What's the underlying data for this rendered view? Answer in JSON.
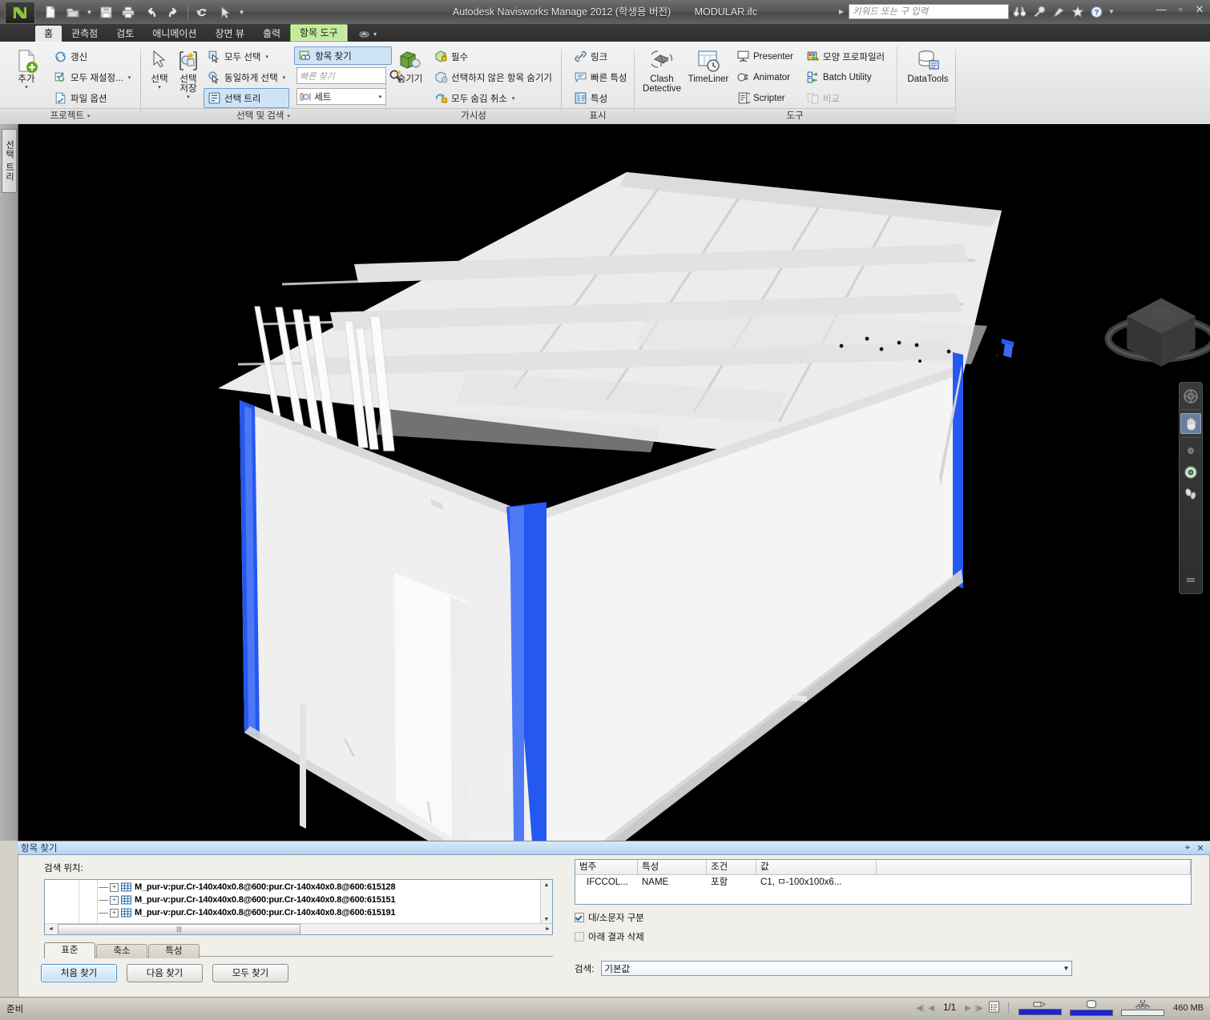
{
  "window": {
    "app_title": "Autodesk Navisworks Manage 2012 (학생용 버전)",
    "file_name": "MODULAR.ifc",
    "minimize": "—",
    "maximize": "▫",
    "close": "✕"
  },
  "quick_access": [
    {
      "name": "new-file-icon",
      "label": "새로 만들기"
    },
    {
      "name": "open-file-icon",
      "label": "열기"
    },
    {
      "name": "open-dropdown-caret",
      "label": "▾"
    },
    {
      "name": "save-icon",
      "label": "저장"
    },
    {
      "name": "print-icon",
      "label": "인쇄"
    },
    {
      "name": "undo-icon",
      "label": "실행 취소"
    },
    {
      "name": "redo-icon",
      "label": "다시 실행"
    },
    {
      "name": "refresh-icon",
      "label": "갱신"
    },
    {
      "name": "select-cursor-icon",
      "label": "선택"
    },
    {
      "name": "qat-dropdown-caret",
      "label": "▾"
    }
  ],
  "title_search": {
    "placeholder": "키워드 또는 구 입력",
    "caret": "▸",
    "icons": [
      "binoculars-icon",
      "wrench-icon",
      "satellite-icon",
      "star-icon",
      "help-icon"
    ],
    "help_caret": "▾"
  },
  "tabs": [
    {
      "label": "홈",
      "state": "active"
    },
    {
      "label": "관측점",
      "state": "normal"
    },
    {
      "label": "검토",
      "state": "normal"
    },
    {
      "label": "애니메이션",
      "state": "normal"
    },
    {
      "label": "장면 뷰",
      "state": "normal"
    },
    {
      "label": "출력",
      "state": "normal"
    },
    {
      "label": "항목 도구",
      "state": "contextual"
    }
  ],
  "ribbon": {
    "groups": [
      {
        "title": "프로젝트",
        "caret": "▾",
        "big": {
          "label": "추가",
          "caret": "▾",
          "icon": "add-file-icon"
        },
        "items": [
          {
            "label": "갱신",
            "icon": "refresh-icon",
            "caret": ""
          },
          {
            "label": "모두 재설정...",
            "icon": "reset-all-icon",
            "caret": "▾"
          },
          {
            "label": "파일 옵션",
            "icon": "file-options-icon",
            "caret": ""
          }
        ]
      },
      {
        "title": "선택 및 검색",
        "caret": "▾",
        "big": [
          {
            "label": "선택",
            "caret": "▾",
            "icon": "select-arrow-icon"
          },
          {
            "label": "선택 저장",
            "caret": "▾",
            "icon": "save-selection-icon"
          }
        ],
        "items": [
          {
            "label": "모두 선택",
            "icon": "select-all-icon",
            "caret": "▾"
          },
          {
            "label": "동일하게 선택",
            "icon": "select-same-icon",
            "caret": "▾"
          },
          {
            "label": "선택 트리",
            "icon": "selection-tree-icon",
            "caret": "",
            "selected": true
          }
        ],
        "items2": [
          {
            "label": "항목 찾기",
            "icon": "find-items-icon",
            "selected": true
          },
          {
            "label": "빠른 찾기",
            "icon": "quick-find-icon",
            "placeholder": true
          },
          {
            "label": "세트",
            "icon": "sets-icon",
            "caret": "▾"
          }
        ]
      },
      {
        "title": "가시성",
        "caret": "",
        "big": {
          "label": "숨기기",
          "caret": "",
          "icon": "hide-icon"
        },
        "items": [
          {
            "label": "필수",
            "icon": "required-icon",
            "caret": ""
          },
          {
            "label": "선택하지 않은 항목 숨기기",
            "icon": "hide-unselected-icon",
            "caret": ""
          },
          {
            "label": "모두 숨김 취소",
            "icon": "unhide-all-icon",
            "caret": "▾"
          }
        ]
      },
      {
        "title": "표시",
        "caret": "",
        "items": [
          {
            "label": "링크",
            "icon": "link-icon"
          },
          {
            "label": "빠른 특성",
            "icon": "quick-properties-icon"
          },
          {
            "label": "특성",
            "icon": "properties-icon"
          }
        ]
      },
      {
        "title": "도구",
        "caret": "",
        "big": [
          {
            "label": "Clash Detective",
            "icon": "clash-detective-icon"
          },
          {
            "label": "TimeLiner",
            "icon": "timeliner-icon"
          }
        ],
        "items": [
          {
            "label": "Presenter",
            "icon": "presenter-icon"
          },
          {
            "label": "Animator",
            "icon": "animator-icon"
          },
          {
            "label": "Scripter",
            "icon": "scripter-icon"
          }
        ],
        "items2": [
          {
            "label": "모양 프로파일러",
            "icon": "appearance-profiler-icon"
          },
          {
            "label": "Batch Utility",
            "icon": "batch-utility-icon"
          },
          {
            "label": "비교",
            "icon": "compare-icon",
            "disabled": true
          }
        ],
        "items3": [
          {
            "label": "DataTools",
            "icon": "datatools-icon"
          }
        ]
      }
    ]
  },
  "left_dock": {
    "tab_label": "선택 트리"
  },
  "viewport": {
    "background_color": "#000000",
    "selection_color": "#2458f0",
    "model_color": "#f2f2f2",
    "viewcube_name": "view-cube",
    "navbar_items": [
      {
        "name": "steering-wheel-icon",
        "active": false
      },
      {
        "name": "pan-hand-icon",
        "active": true
      },
      {
        "name": "zoom-icon",
        "active": false
      },
      {
        "name": "orbit-icon",
        "active": false
      },
      {
        "name": "walk-icon",
        "active": false
      },
      {
        "name": "navbar-menu-icon",
        "active": false
      }
    ]
  },
  "find_items": {
    "title": "항목 찾기",
    "pin": "⌖",
    "close": "✕",
    "search_in_label": "검색 위치:",
    "tree_rows": [
      {
        "expander": "+",
        "label": "M_pur-v:pur.Cr-140x40x0.8@600:pur.Cr-140x40x0.8@600:615128"
      },
      {
        "expander": "+",
        "label": "M_pur-v:pur.Cr-140x40x0.8@600:pur.Cr-140x40x0.8@600:615151"
      },
      {
        "expander": "+",
        "label": "M_pur-v:pur.Cr-140x40x0.8@600:pur.Cr-140x40x0.8@600:615191"
      }
    ],
    "scroll": {
      "up": "▲",
      "down": "▼",
      "left": "◄",
      "right": "►",
      "grip": "|||"
    },
    "bottom_tabs": [
      {
        "label": "표준",
        "active": true
      },
      {
        "label": "축소",
        "active": false
      },
      {
        "label": "특성",
        "active": false
      }
    ],
    "buttons": [
      {
        "label": "처음 찾기",
        "primary": true
      },
      {
        "label": "다음 찾기",
        "primary": false
      },
      {
        "label": "모두 찾기",
        "primary": false
      }
    ],
    "grid": {
      "headers": [
        "범주",
        "특성",
        "조건",
        "값",
        ""
      ],
      "rows": [
        {
          "category": "IFCCOL...",
          "property": "NAME",
          "condition": "포함",
          "value": "C1, ㅁ-100x100x6...",
          "extra": ""
        }
      ]
    },
    "checkboxes": [
      {
        "label": "대/소문자 구분",
        "checked": true
      },
      {
        "label": "아래 결과 삭제",
        "checked": false
      }
    ],
    "search_mode": {
      "label": "검색:",
      "value": "기본값",
      "caret": "▼"
    }
  },
  "status_bar": {
    "ready": "준비",
    "nav": {
      "first": "◀|",
      "prev": "◀",
      "next": "▶",
      "last": "|▶"
    },
    "page": "1/1",
    "sheet_icon": "sheet-list-icon",
    "meters": [
      {
        "name": "pencil-meter",
        "percent": 100
      },
      {
        "name": "disk-meter",
        "percent": 100
      },
      {
        "name": "network-meter",
        "percent": 0
      }
    ],
    "memory": "460 MB"
  }
}
